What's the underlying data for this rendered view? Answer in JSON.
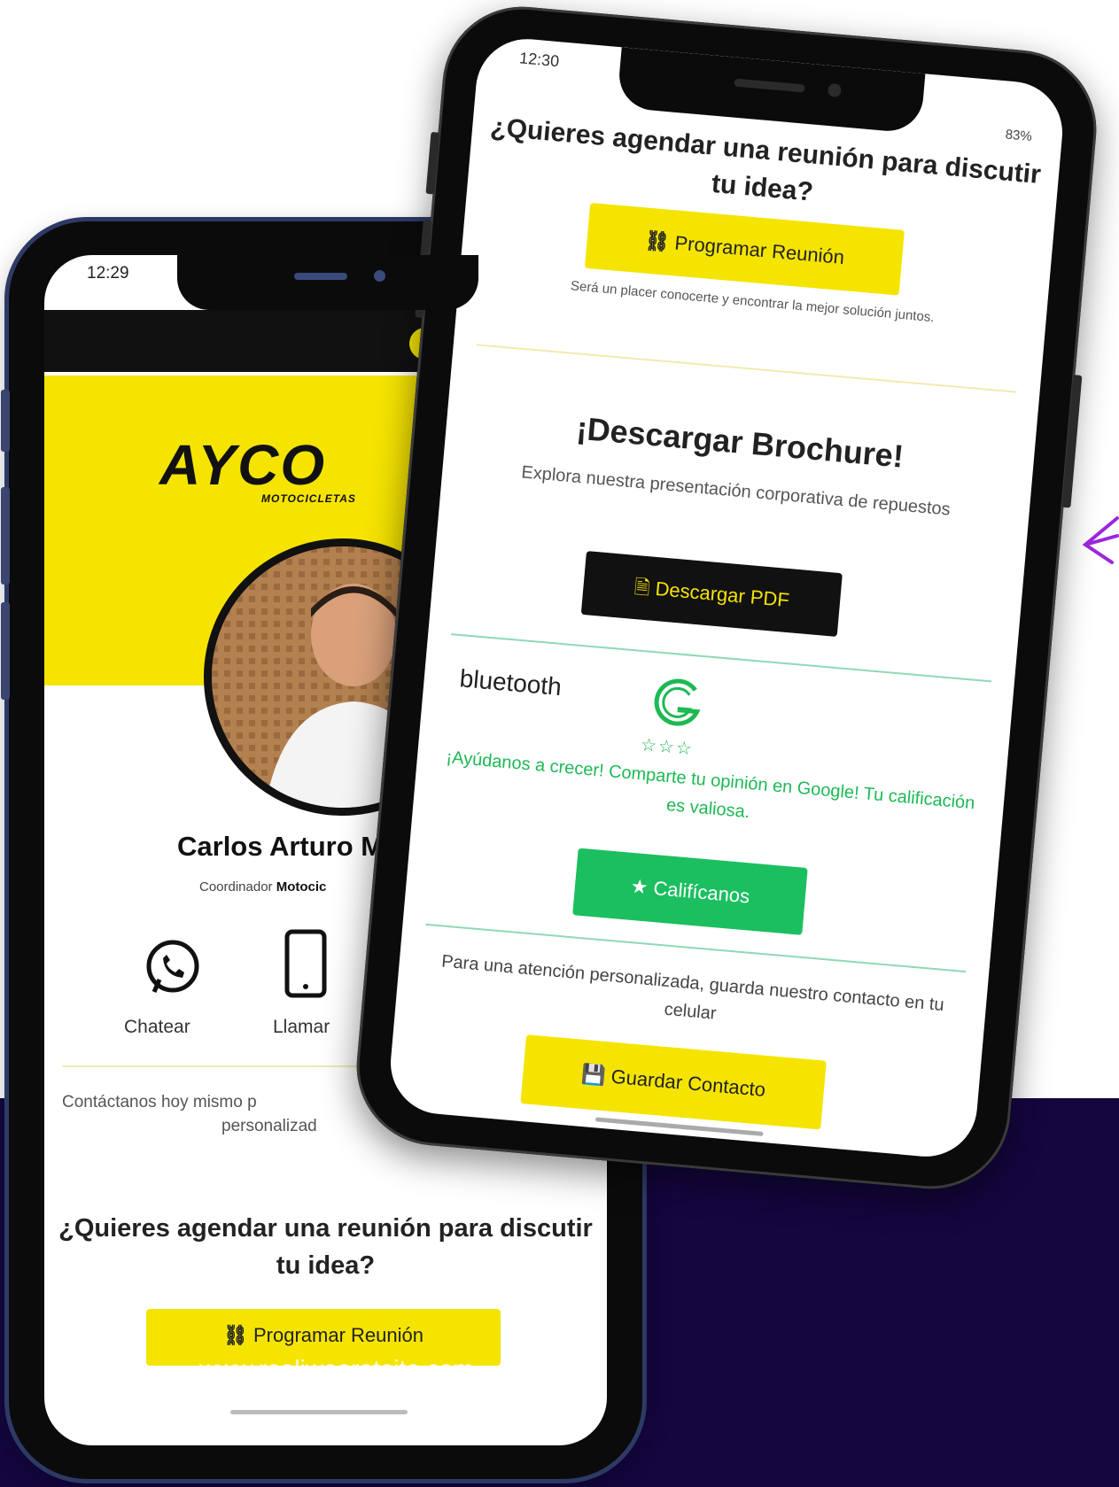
{
  "colors": {
    "brand_yellow": "#f5e400",
    "dark_background": "#14063f",
    "review_green": "#1cbf60",
    "black": "#111111"
  },
  "back_phone": {
    "status_time": "12:29",
    "logo": {
      "name": "AYCO",
      "sub": "MOTOCICLETAS"
    },
    "social_icon": "facebook-icon",
    "profile": {
      "name": "Carlos Arturo M",
      "role_prefix": "Coordinador",
      "role_bold": "Motocic"
    },
    "actions": [
      {
        "label": "Chatear",
        "icon": "whatsapp-icon"
      },
      {
        "label": "Llamar",
        "icon": "phone-icon"
      }
    ],
    "contact_line1": "Contáctanos hoy mismo p",
    "contact_line2": "personalizad",
    "meeting_heading": "¿Quieres agendar una reunión para discutir tu idea?",
    "meeting_button": "Programar Reunión",
    "watermark": "www.realiweorateito.com"
  },
  "front_phone": {
    "status_time": "12:30",
    "battery": "83%",
    "meeting_heading": "¿Quieres agendar una reunión para discutir tu idea?",
    "meeting_button": "Programar Reunión",
    "meeting_note": "Será un placer conocerte y encontrar la mejor solución juntos.",
    "brochure_title": "¡Descargar Brochure!",
    "brochure_text": "Explora nuestra presentación corporativa de repuestos",
    "brochure_button": "Descargar PDF",
    "bluetooth_label": "bluetooth",
    "stars": "☆☆☆",
    "review_text": "¡Ayúdanos a crecer! Comparte tu opinión en Google! Tu calificación es valiosa.",
    "review_button": "Califícanos",
    "save_text": "Para una atención personalizada, guarda nuestro contacto en tu celular",
    "save_button": "Guardar Contacto"
  }
}
